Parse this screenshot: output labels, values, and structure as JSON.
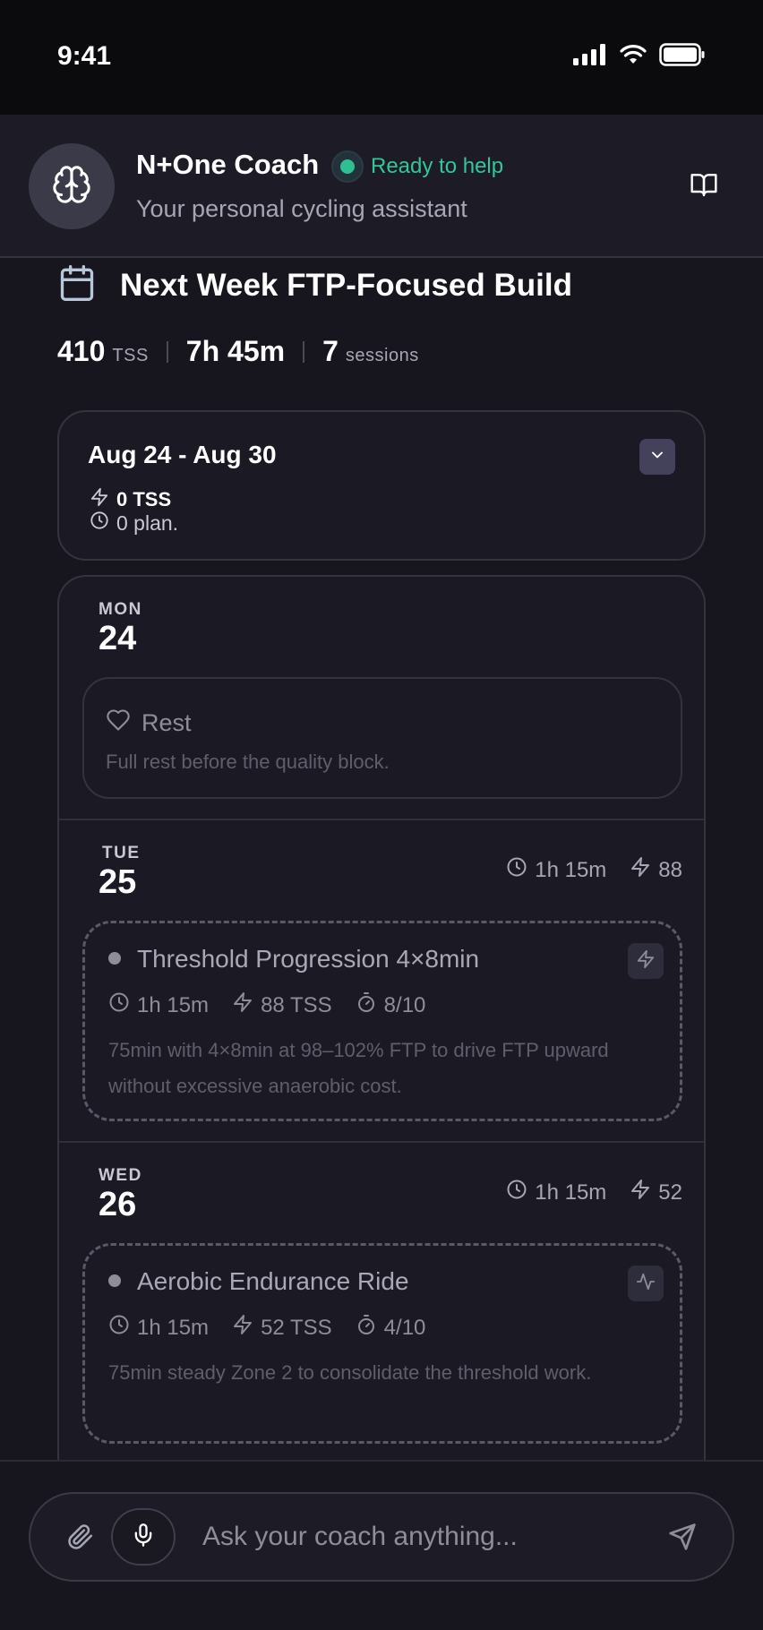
{
  "status_bar": {
    "time": "9:41",
    "icons": [
      "signal-icon",
      "wifi-icon",
      "battery-icon"
    ]
  },
  "header": {
    "coach_name": "N+One Coach",
    "status": "Ready to help",
    "subtitle": "Your personal cycling assistant",
    "avatar_icon": "brain-icon",
    "action_icon": "book-icon",
    "status_color": "#2fbf93"
  },
  "plan": {
    "title": "Next Week FTP-Focused Build",
    "title_icon": "calendar-icon",
    "stats": {
      "tss": "410",
      "tss_unit": "TSS",
      "duration": "7h 45m",
      "sessions": "7",
      "sessions_unit": "sessions"
    }
  },
  "week": {
    "range": "Aug 24 - Aug 30",
    "tss": "0 TSS",
    "planned": "0 plan.",
    "toggle_icon": "chevron-down-icon"
  },
  "days": [
    {
      "abbr": "MON",
      "num": "24",
      "rest": {
        "title": "Rest",
        "desc": "Full rest before the quality block.",
        "icon": "heart-icon"
      }
    },
    {
      "abbr": "TUE",
      "num": "25",
      "duration": "1h 15m",
      "tss": "88",
      "workout": {
        "title": "Threshold Progression 4×8min",
        "duration": "1h 15m",
        "tss": "88 TSS",
        "intensity": "8/10",
        "desc": "75min with 4×8min at 98–102% FTP to drive FTP upward without excessive anaerobic cost.",
        "type_icon": "bolt-icon"
      }
    },
    {
      "abbr": "WED",
      "num": "26",
      "duration": "1h 15m",
      "tss": "52",
      "workout": {
        "title": "Aerobic Endurance Ride",
        "duration": "1h 15m",
        "tss": "52 TSS",
        "intensity": "4/10",
        "desc": "75min steady Zone 2 to consolidate the threshold work.",
        "type_icon": "activity-icon"
      }
    }
  ],
  "composer": {
    "placeholder": "Ask your coach anything...",
    "icons": [
      "paperclip-icon",
      "mic-icon",
      "send-icon"
    ]
  }
}
